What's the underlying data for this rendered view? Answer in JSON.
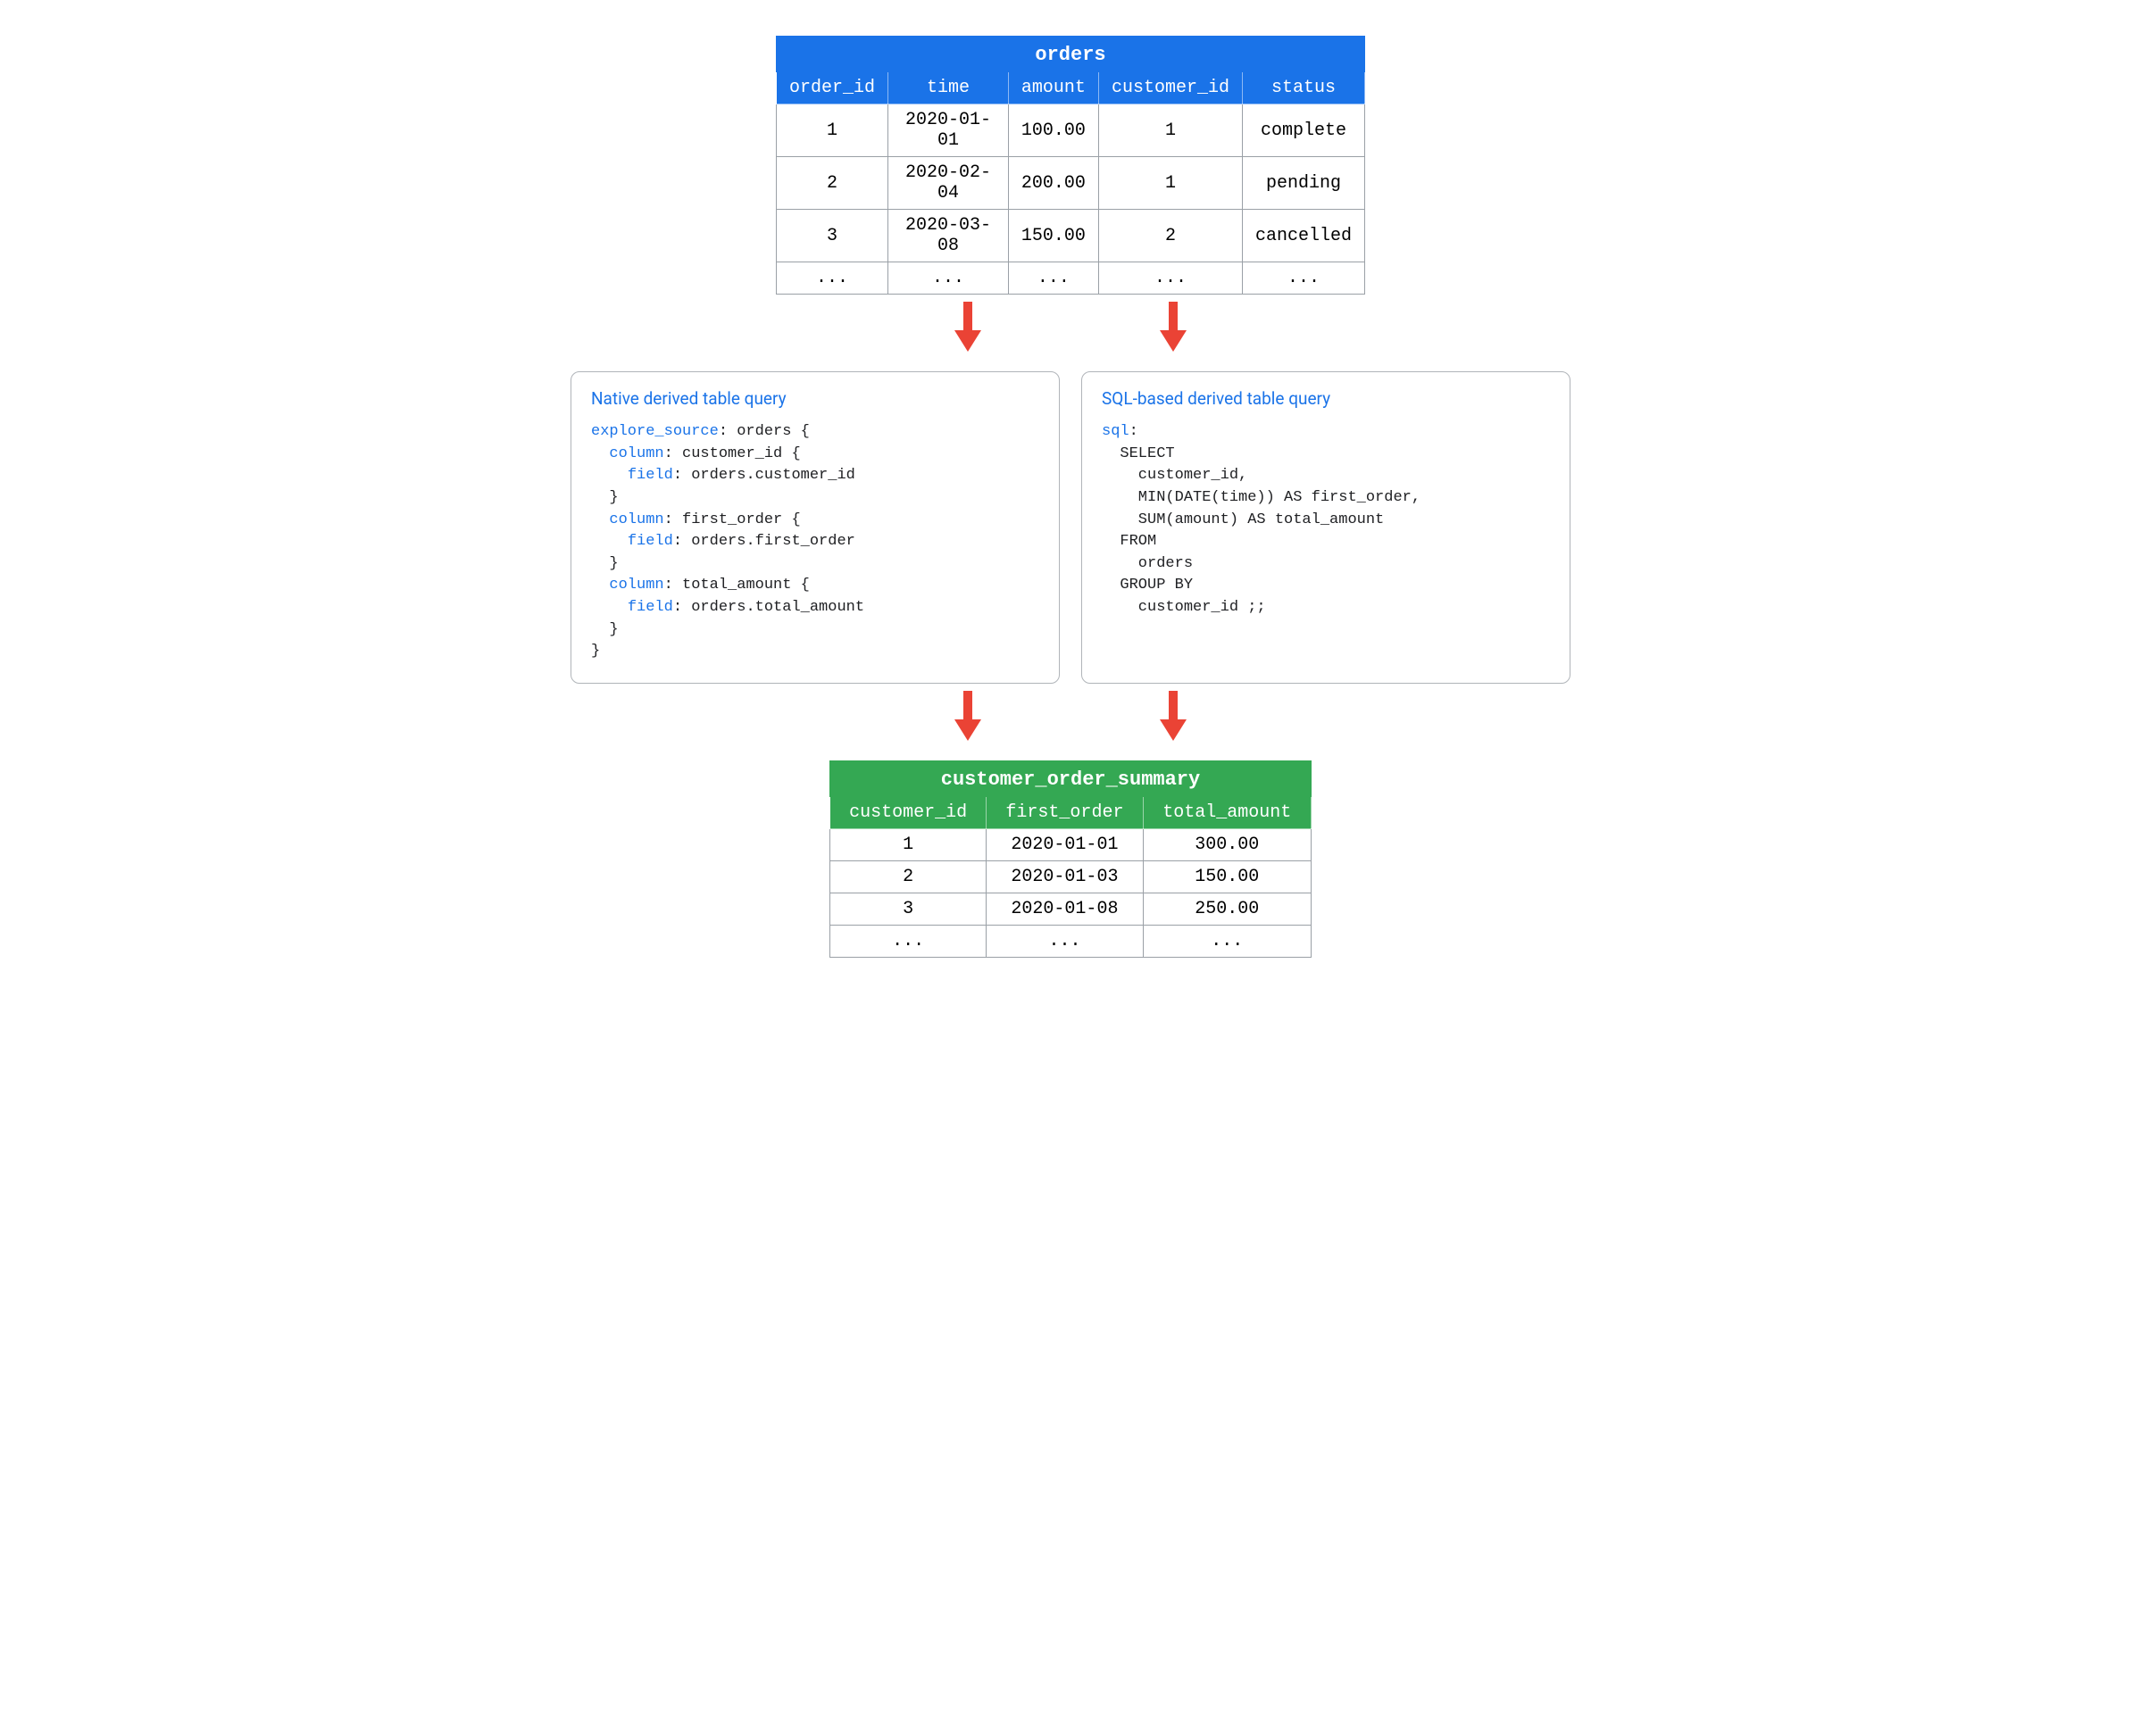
{
  "orders_table": {
    "title": "orders",
    "columns": [
      "order_id",
      "time",
      "amount",
      "customer_id",
      "status"
    ],
    "rows": [
      [
        "1",
        "2020-01-01",
        "100.00",
        "1",
        "complete"
      ],
      [
        "2",
        "2020-02-04",
        "200.00",
        "1",
        "pending"
      ],
      [
        "3",
        "2020-03-08",
        "150.00",
        "2",
        "cancelled"
      ],
      [
        "...",
        "...",
        "...",
        "...",
        "..."
      ]
    ]
  },
  "native_card": {
    "title": "Native derived table query",
    "code_tokens": [
      {
        "t": "explore_source",
        "kw": true
      },
      {
        "t": ": orders {\n"
      },
      {
        "t": "  "
      },
      {
        "t": "column",
        "kw": true
      },
      {
        "t": ": customer_id {\n"
      },
      {
        "t": "    "
      },
      {
        "t": "field",
        "kw": true
      },
      {
        "t": ": orders.customer_id\n"
      },
      {
        "t": "  }\n"
      },
      {
        "t": "  "
      },
      {
        "t": "column",
        "kw": true
      },
      {
        "t": ": first_order {\n"
      },
      {
        "t": "    "
      },
      {
        "t": "field",
        "kw": true
      },
      {
        "t": ": orders.first_order\n"
      },
      {
        "t": "  }\n"
      },
      {
        "t": "  "
      },
      {
        "t": "column",
        "kw": true
      },
      {
        "t": ": total_amount {\n"
      },
      {
        "t": "    "
      },
      {
        "t": "field",
        "kw": true
      },
      {
        "t": ": orders.total_amount\n"
      },
      {
        "t": "  }\n"
      },
      {
        "t": "}"
      }
    ]
  },
  "sql_card": {
    "title": "SQL-based derived table query",
    "code_tokens": [
      {
        "t": "sql",
        "kw": true
      },
      {
        "t": ":\n"
      },
      {
        "t": "  SELECT\n"
      },
      {
        "t": "    customer_id,\n"
      },
      {
        "t": "    MIN(DATE(time)) AS first_order,\n"
      },
      {
        "t": "    SUM(amount) AS total_amount\n"
      },
      {
        "t": "  FROM\n"
      },
      {
        "t": "    orders\n"
      },
      {
        "t": "  GROUP BY\n"
      },
      {
        "t": "    customer_id ;;"
      }
    ]
  },
  "summary_table": {
    "title": "customer_order_summary",
    "columns": [
      "customer_id",
      "first_order",
      "total_amount"
    ],
    "rows": [
      [
        "1",
        "2020-01-01",
        "300.00"
      ],
      [
        "2",
        "2020-01-03",
        "150.00"
      ],
      [
        "3",
        "2020-01-08",
        "250.00"
      ],
      [
        "...",
        "...",
        "..."
      ]
    ]
  },
  "colors": {
    "blue": "#1a73e8",
    "green": "#34a853",
    "arrow": "#ea4335"
  }
}
